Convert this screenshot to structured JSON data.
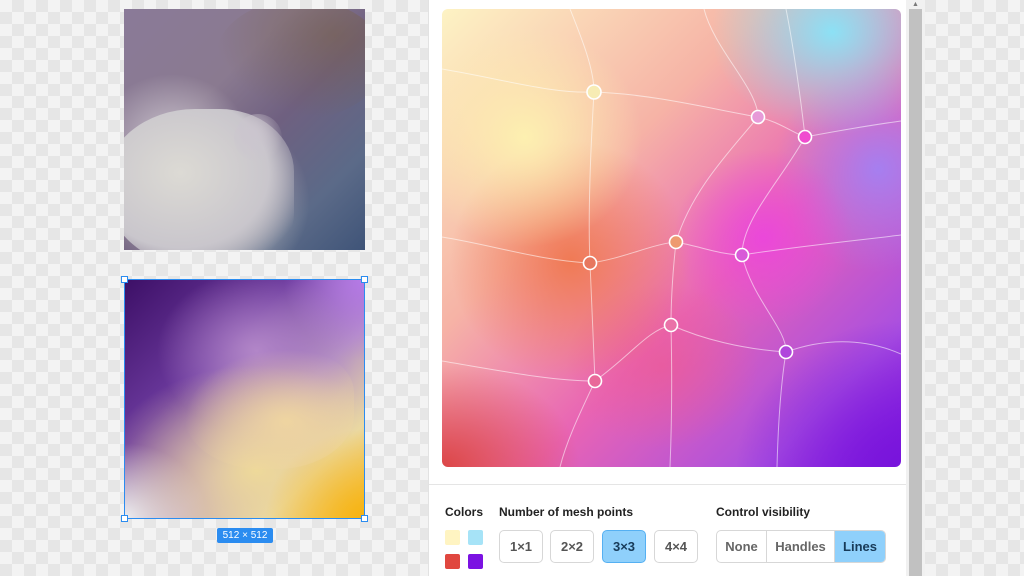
{
  "canvas": {
    "selection_size_label": "512 × 512"
  },
  "panel": {
    "colors": {
      "label": "Colors",
      "swatches": [
        "#fff4c2",
        "#a6e3f7",
        "#e0473f",
        "#7b12e2"
      ]
    },
    "mesh_points": {
      "label": "Number of mesh points",
      "options": [
        "1×1",
        "2×2",
        "3×3",
        "4×4"
      ],
      "selected": "3×3"
    },
    "control_visibility": {
      "label": "Control visibility",
      "options": [
        "None",
        "Handles",
        "Lines"
      ],
      "selected": "Lines"
    }
  },
  "accent_color": "#2b8cf0",
  "active_button_color": "#8fd0fb"
}
